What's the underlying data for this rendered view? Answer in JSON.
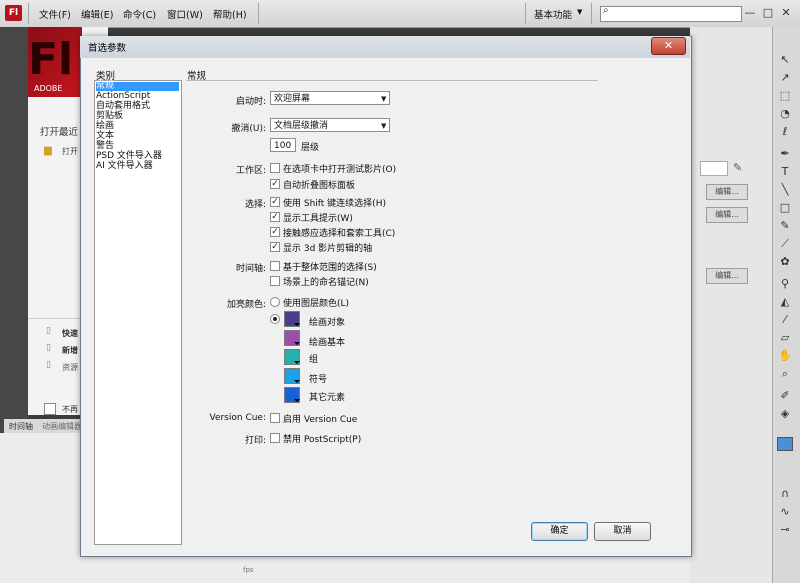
{
  "app": {
    "logo": "Fl",
    "menu": [
      "文件(F)",
      "编辑(E)",
      "命令(C)",
      "窗口(W)",
      "帮助(H)"
    ],
    "workspace": "基本功能",
    "search_placeholder": "",
    "window_controls": [
      "—",
      "□",
      "✕"
    ]
  },
  "background": {
    "banner_letters": "Fl",
    "adobe": "ADOBE",
    "open_recent": "打开最近",
    "open_item": "打开",
    "quick_items": [
      "快速",
      "新增",
      "资源"
    ],
    "dont_show": "不再",
    "timeline_tabs": [
      "时间轴",
      "动画编辑器"
    ],
    "edit_label": "编辑...",
    "fps": "fps"
  },
  "dialog": {
    "title": "首选参数",
    "close": "✕",
    "category_label": "类别",
    "categories": [
      "常规",
      "ActionScript",
      "自动套用格式",
      "剪贴板",
      "绘画",
      "文本",
      "警告",
      "PSD 文件导入器",
      "AI 文件导入器"
    ],
    "selected_category": 0,
    "section_title": "常规",
    "startup": {
      "label": "启动时:",
      "value": "欢迎屏幕"
    },
    "undo": {
      "label": "撤消(U):",
      "value": "文档层级撤消",
      "levels": "100",
      "levels_label": "层级"
    },
    "workspace": {
      "label": "工作区:",
      "options": [
        {
          "text": "在选项卡中打开测试影片(O)",
          "checked": false
        },
        {
          "text": "自动折叠图标面板",
          "checked": true
        }
      ]
    },
    "selection": {
      "label": "选择:",
      "options": [
        {
          "text": "使用 Shift 键连续选择(H)",
          "checked": true
        },
        {
          "text": "显示工具提示(W)",
          "checked": true
        },
        {
          "text": "接触感应选择和套索工具(C)",
          "checked": true
        },
        {
          "text": "显示 3d 影片剪辑的轴",
          "checked": true
        }
      ]
    },
    "timeline": {
      "label": "时间轴:",
      "options": [
        {
          "text": "基于整体范围的选择(S)",
          "checked": false
        },
        {
          "text": "场景上的命名锚记(N)",
          "checked": false
        }
      ]
    },
    "highlight": {
      "label": "加亮颜色:",
      "radio1": "使用图层颜色(L)",
      "radio1_selected": false,
      "radio2_selected": true,
      "swatches": [
        {
          "label": "绘画对象",
          "color": "#4b3e8f"
        },
        {
          "label": "绘画基本",
          "color": "#9c4fa8"
        },
        {
          "label": "组",
          "color": "#23b0b0"
        },
        {
          "label": "符号",
          "color": "#1aa3e6"
        },
        {
          "label": "其它元素",
          "color": "#1660d8"
        }
      ]
    },
    "version_cue": {
      "label": "Version Cue:",
      "text": "启用 Version Cue",
      "checked": false
    },
    "print": {
      "label": "打印:",
      "text": "禁用 PostScript(P)",
      "checked": false
    },
    "ok": "确定",
    "cancel": "取消"
  }
}
